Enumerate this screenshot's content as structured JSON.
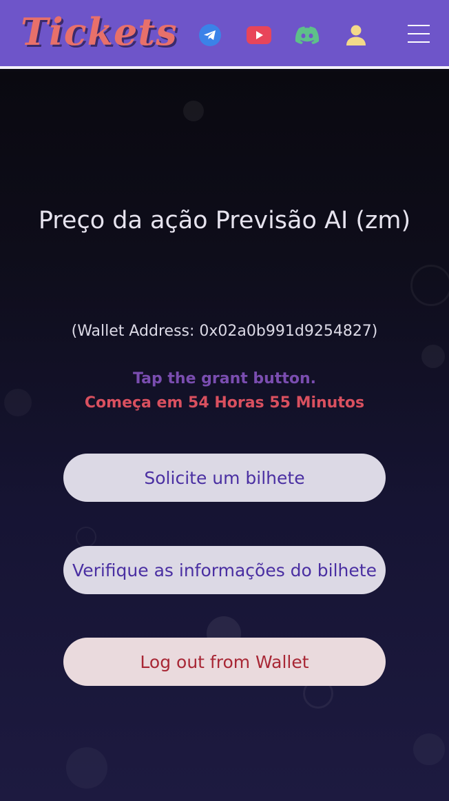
{
  "header": {
    "logo": "Tickets",
    "icons": [
      "telegram-icon",
      "youtube-icon",
      "discord-icon",
      "user-icon",
      "menu-icon"
    ],
    "colors": {
      "background": "#6e55c9",
      "logo": "#e8706a",
      "telegram": "#3b82e8",
      "youtube": "#e8455a",
      "discord": "#5ec08a",
      "user": "#f3d98a"
    }
  },
  "main": {
    "title": "Preço da ação Previsão AI (zm)",
    "wallet_text": "(Wallet Address: 0x02a0b991d9254827)",
    "grant_text": "Tap the grant button.",
    "countdown_text": "Começa em 54 Horas 55 Minutos",
    "buttons": {
      "request": "Solicite um bilhete",
      "verify": "Verifique as informações do bilhete",
      "logout": "Log out from Wallet"
    }
  }
}
